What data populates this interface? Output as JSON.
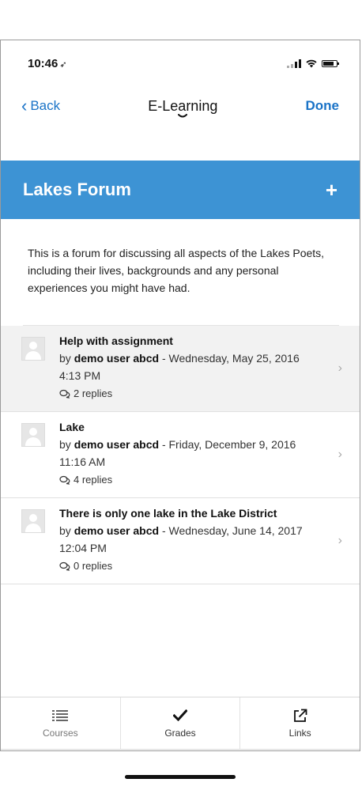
{
  "status": {
    "time": "10:46",
    "location_arrow": "➶"
  },
  "nav": {
    "back_label": "Back",
    "title": "E-Learning",
    "done_label": "Done"
  },
  "forum": {
    "title": "Lakes Forum",
    "add_label": "+",
    "description": "This is a forum for discussing all aspects of the Lakes Poets, including their lives, backgrounds and any personal experiences you might have had."
  },
  "discussions": [
    {
      "subject": "Help with assignment",
      "by": "by ",
      "author": "demo user abcd",
      "date": " - Wednesday, May 25, 2016 4:13 PM",
      "replies": "2 replies"
    },
    {
      "subject": "Lake",
      "by": "by ",
      "author": "demo user abcd",
      "date": " - Friday, December 9, 2016 11:16 AM",
      "replies": "4 replies"
    },
    {
      "subject": "There is only one lake in the Lake District",
      "by": "by ",
      "author": "demo user abcd",
      "date": " - Wednesday, June 14, 2017 12:04 PM",
      "replies": "0 replies"
    }
  ],
  "tabs": [
    {
      "label": "Courses",
      "icon": "list-icon"
    },
    {
      "label": "Grades",
      "icon": "checkmark-icon"
    },
    {
      "label": "Links",
      "icon": "external-link-icon"
    }
  ],
  "colors": {
    "accent": "#3d93d4",
    "link": "#1a73c7"
  }
}
